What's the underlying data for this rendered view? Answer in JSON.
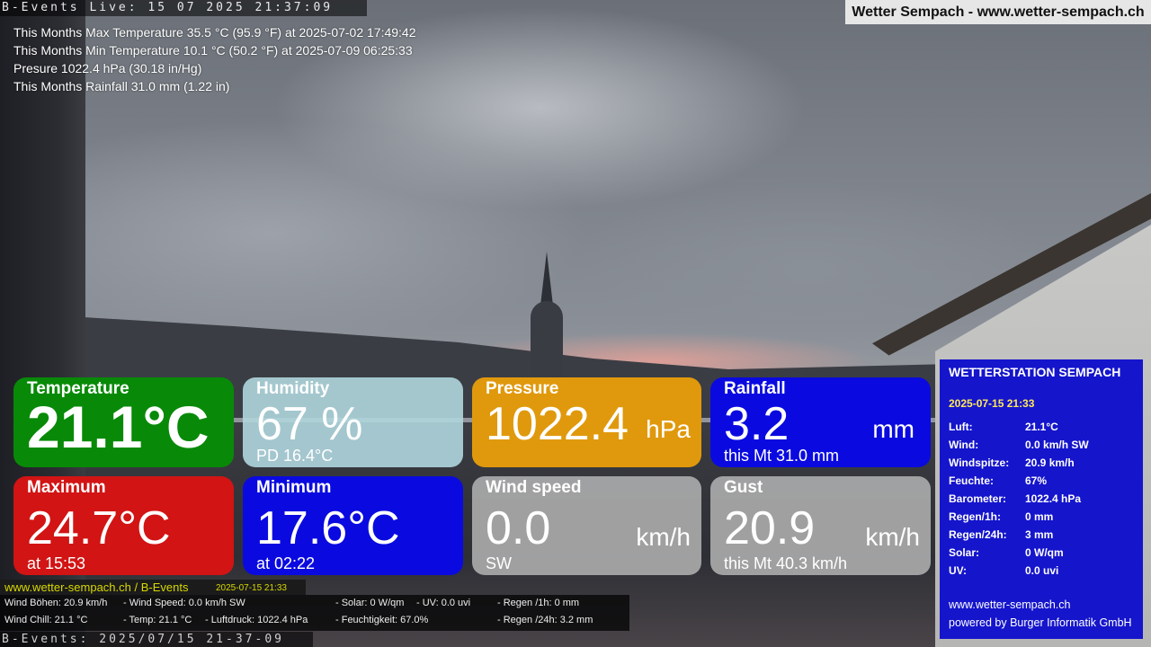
{
  "header": {
    "live_stamp": "B-Events Live: 15 07 2025 21:37:09",
    "site_title": "Wetter Sempach - www.wetter-sempach.ch"
  },
  "stats": [
    "This Months Max Temperature 35.5 °C (95.9 °F) at 2025-07-02 17:49:42",
    "This Months Min Temperature 10.1 °C (50.2 °F) at 2025-07-09 06:25:33",
    "Presure 1022.4 hPa (30.18 in/Hg)",
    "This Months Rainfall 31.0 mm (1.22 in)"
  ],
  "tiles": {
    "temperature": {
      "label": "Temperature",
      "value": "21.1°C",
      "color": "#088a08"
    },
    "humidity": {
      "label": "Humidity",
      "value": "67 %",
      "sub": "PD 16.4°C",
      "color": "#b0d6de"
    },
    "pressure": {
      "label": "Pressure",
      "value": "1022.4",
      "unit": "hPa",
      "color": "#e0990d"
    },
    "rainfall": {
      "label": "Rainfall",
      "value": "3.2",
      "unit": "mm",
      "sub": "this Mt 31.0 mm",
      "color": "#0a0ae0"
    },
    "maximum": {
      "label": "Maximum",
      "value": "24.7°C",
      "sub": "at 15:53",
      "color": "#d21414"
    },
    "minimum": {
      "label": "Minimum",
      "value": "17.6°C",
      "sub": "at 02:22",
      "color": "#0a0ae0"
    },
    "wind_speed": {
      "label": "Wind speed",
      "value": "0.0",
      "unit": "km/h",
      "sub": "SW",
      "color": "#b4b4b4"
    },
    "gust": {
      "label": "Gust",
      "value": "20.9",
      "unit": "km/h",
      "sub": "this Mt 40.3 km/h",
      "color": "#b4b4b4"
    }
  },
  "panel": {
    "title": "WETTERSTATION SEMPACH",
    "date": "2025-07-15 21:33",
    "rows": [
      {
        "key": "Luft:",
        "val": "21.1°C"
      },
      {
        "key": "Wind:",
        "val": "0.0 km/h  SW"
      },
      {
        "key": "Windspitze:",
        "val": "20.9 km/h"
      },
      {
        "key": "Feuchte:",
        "val": "67%"
      },
      {
        "key": "Barometer:",
        "val": "1022.4 hPa"
      },
      {
        "key": "Regen/1h:",
        "val": "0 mm"
      },
      {
        "key": "Regen/24h:",
        "val": "3 mm"
      },
      {
        "key": "Solar:",
        "val": "0 W/qm"
      },
      {
        "key": "UV:",
        "val": "0.0 uvi"
      }
    ],
    "footer_url": "www.wetter-sempach.ch",
    "footer_credit": "powered by Burger Informatik GmbH"
  },
  "ticker": {
    "link": "www.wetter-sempach.ch / B-Events",
    "date": "2025-07-15 21:33",
    "row1": [
      "Wind Böhen: 20.9 km/h",
      "- Wind Speed: 0.0 km/h SW",
      "- Solar: 0 W/qm",
      "- UV: 0.0 uvi",
      "- Regen /1h:   0 mm"
    ],
    "row2": [
      "Wind Chill: 21.1 °C",
      "- Temp: 21.1 °C",
      "- Luftdruck: 1022.4 hPa",
      "- Feuchtigkeit: 67.0%",
      "- Regen /24h: 3.2 mm"
    ]
  },
  "footer_stamp": "B-Events: 2025/07/15 21-37-09"
}
